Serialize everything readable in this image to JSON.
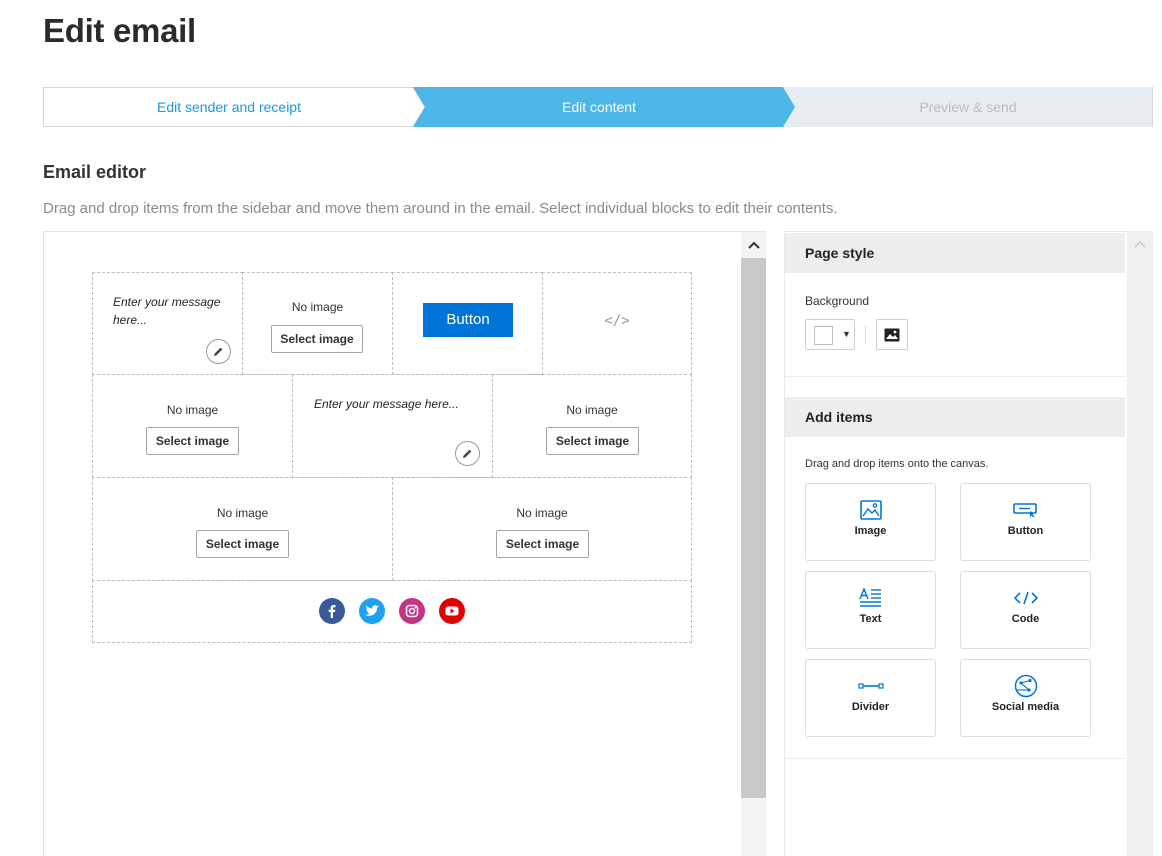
{
  "page": {
    "title": "Edit email"
  },
  "stepper": {
    "steps": [
      {
        "label": "Edit sender and receipt",
        "state": "completed"
      },
      {
        "label": "Edit content",
        "state": "active"
      },
      {
        "label": "Preview & send",
        "state": "upcoming"
      }
    ],
    "colors": {
      "completed_text": "#1a9ad6",
      "active_bg": "#4db6e8",
      "upcoming_bg": "#e6ecef"
    }
  },
  "editor": {
    "title": "Email editor",
    "description": "Drag and drop items from the sidebar and move them around in the email. Select individual blocks to edit their contents."
  },
  "email": {
    "row1": {
      "text_block": "Enter your message here...",
      "image_block": {
        "status": "No image",
        "button": "Select image"
      },
      "button_block": {
        "label": "Button",
        "color": "#0075d9"
      },
      "code_block": {
        "glyph": "</>"
      }
    },
    "row2": {
      "image_left": {
        "status": "No image",
        "button": "Select image"
      },
      "text_block": "Enter your message here...",
      "image_right": {
        "status": "No image",
        "button": "Select image"
      }
    },
    "row3": {
      "image_left": {
        "status": "No image",
        "button": "Select image"
      },
      "image_right": {
        "status": "No image",
        "button": "Select image"
      }
    },
    "social": [
      {
        "name": "facebook-icon",
        "color": "#3b5998",
        "glyph": "f"
      },
      {
        "name": "twitter-icon",
        "color": "#1da1f2",
        "glyph": "t"
      },
      {
        "name": "instagram-icon",
        "color": "#c13584",
        "glyph": "ig"
      },
      {
        "name": "youtube-icon",
        "color": "#e00000",
        "glyph": "yt"
      }
    ]
  },
  "sidebar": {
    "page_style": {
      "title": "Page style",
      "background_label": "Background",
      "background_color": "#ffffff"
    },
    "add_items": {
      "title": "Add items",
      "description": "Drag and drop items onto the canvas.",
      "items": [
        {
          "label": "Image",
          "icon": "image-icon"
        },
        {
          "label": "Button",
          "icon": "button-icon"
        },
        {
          "label": "Text",
          "icon": "text-icon"
        },
        {
          "label": "Code",
          "icon": "code-icon"
        },
        {
          "label": "Divider",
          "icon": "divider-icon"
        },
        {
          "label": "Social media",
          "icon": "social-media-icon"
        }
      ],
      "icon_color": "#0075d9"
    }
  }
}
